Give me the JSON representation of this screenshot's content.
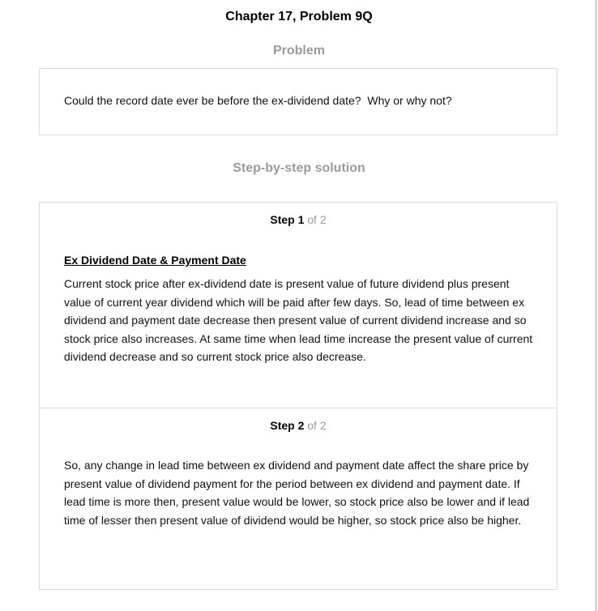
{
  "header": {
    "chapter_title": "Chapter 17, Problem 9Q"
  },
  "problem": {
    "heading": "Problem",
    "text": "Could the record date ever be before the ex-dividend date?  Why or why not?"
  },
  "solution": {
    "heading": "Step-by-step solution",
    "steps": [
      {
        "label": "Step 1",
        "of_label": "of 2",
        "subtitle": "Ex Dividend Date & Payment Date",
        "body": "Current stock price after ex-dividend date is present value of future dividend plus present value of current year dividend which will be paid after few days. So, lead of time between ex dividend and payment date decrease then present value of current dividend increase and so stock price also increases. At same time when lead time increase the present value of current dividend decrease and so current stock price also decrease."
      },
      {
        "label": "Step 2",
        "of_label": "of 2",
        "body": "So, any change in lead time between ex dividend and payment date affect the share price by present value of dividend payment for the period between ex dividend and payment date. If lead time is more then, present value would be lower, so stock price also be lower and if lead time of lesser then present value of dividend would be higher, so stock price also be higher."
      }
    ]
  }
}
